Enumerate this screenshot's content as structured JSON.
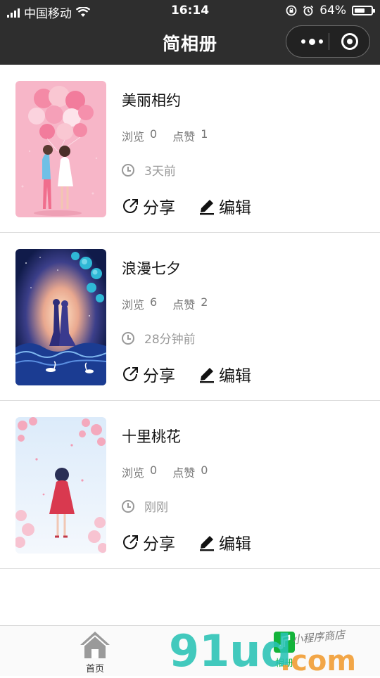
{
  "status_bar": {
    "carrier": "中国移动",
    "time": "16:14",
    "battery": "64%",
    "battery_level": 0.64
  },
  "nav": {
    "title": "简相册"
  },
  "albums": [
    {
      "name": "美丽相约",
      "views_label": "浏览",
      "views": "0",
      "likes_label": "点赞",
      "likes": "1",
      "time": "3天前",
      "share": "分享",
      "edit": "编辑"
    },
    {
      "name": "浪漫七夕",
      "views_label": "浏览",
      "views": "6",
      "likes_label": "点赞",
      "likes": "2",
      "time": "28分钟前",
      "share": "分享",
      "edit": "编辑"
    },
    {
      "name": "十里桃花",
      "views_label": "浏览",
      "views": "0",
      "likes_label": "点赞",
      "likes": "0",
      "time": "刚刚",
      "share": "分享",
      "edit": "编辑"
    }
  ],
  "tabbar": {
    "home": "首页",
    "album": "相册"
  },
  "watermark": {
    "brand": "91ud",
    "suffix": ".com",
    "slogan": "小程序商店"
  },
  "colors": {
    "nav_bg": "#2e2e2e",
    "tab_active": "#13b33a",
    "divider": "#dcdcdc"
  }
}
